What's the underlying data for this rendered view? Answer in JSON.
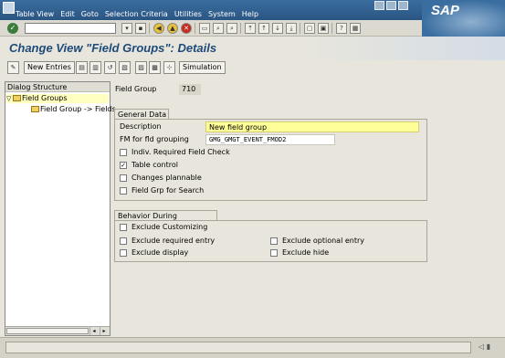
{
  "menu": [
    "Table View",
    "Edit",
    "Goto",
    "Selection Criteria",
    "Utilities",
    "System",
    "Help"
  ],
  "brand": {
    "logo_text": "SAP"
  },
  "toolbar": {
    "command_value": ""
  },
  "title": "Change View \"Field Groups\": Details",
  "app_toolbar": {
    "new_entries_label": "New Entries",
    "simulation_label": "Simulation"
  },
  "dialog_structure": {
    "header": "Dialog Structure",
    "items": [
      {
        "label": "Field Groups",
        "selected": true
      },
      {
        "label": "Field Group -> Fields",
        "selected": false
      }
    ]
  },
  "field_group": {
    "label": "Field Group",
    "value": "710"
  },
  "general_data": {
    "title": "General Data",
    "description_label": "Description",
    "description_value": "New field group",
    "fm_label": "FM for fld grouping",
    "fm_value": "GMG_GMGT_EVENT_FMOD2",
    "checkboxes": [
      {
        "label": "Indiv. Required Field Check",
        "checked": false
      },
      {
        "label": "Table control",
        "checked": true
      },
      {
        "label": "Changes plannable",
        "checked": false
      },
      {
        "label": "Field Grp for Search",
        "checked": false
      }
    ]
  },
  "behavior": {
    "title": "Behavior During Customizing",
    "checkboxes": [
      {
        "label": "Exclude Customizing",
        "checked": false
      },
      {
        "label": "Exclude required entry",
        "checked": false
      },
      {
        "label": "Exclude optional entry",
        "checked": false
      },
      {
        "label": "Exclude display",
        "checked": false
      },
      {
        "label": "Exclude hide",
        "checked": false
      }
    ]
  },
  "colors": {
    "title": "#1e4a7a",
    "menubar": "#2a5582",
    "description_bg": "#ffff99",
    "selected_tree_bg": "#ffffc0"
  }
}
